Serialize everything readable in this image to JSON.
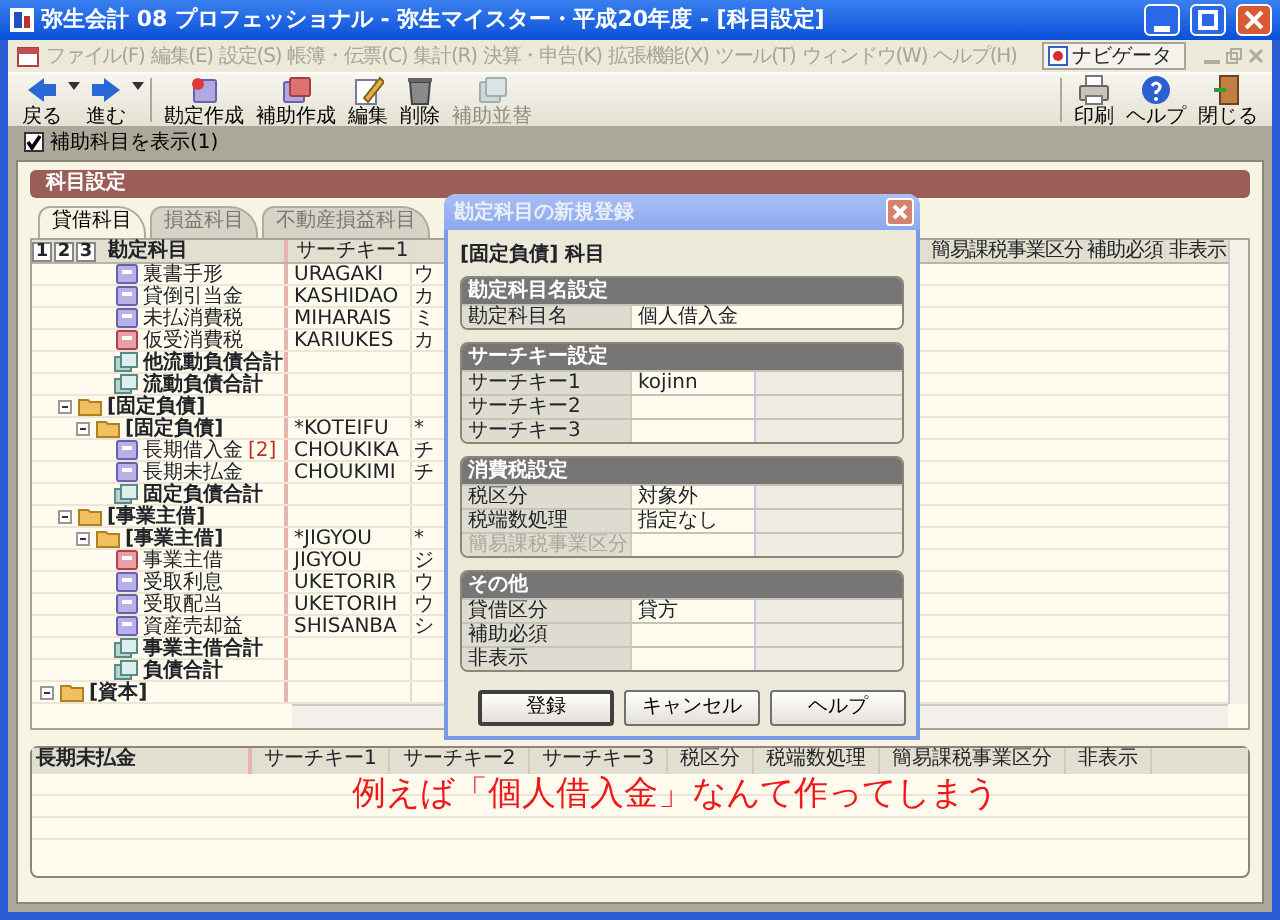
{
  "window": {
    "title": "弥生会計 08 プロフェッショナル - 弥生マイスター・平成20年度 - [科目設定]"
  },
  "menu": [
    {
      "label": "ファイル(F)",
      "disabled": true
    },
    {
      "label": "編集(E)",
      "disabled": true
    },
    {
      "label": "設定(S)",
      "disabled": true
    },
    {
      "label": "帳簿・伝票(C)",
      "disabled": true
    },
    {
      "label": "集計(R)",
      "disabled": true
    },
    {
      "label": "決算・申告(K)",
      "disabled": true
    },
    {
      "label": "拡張機能(X)",
      "disabled": true
    },
    {
      "label": "ツール(T)",
      "disabled": true
    },
    {
      "label": "ウィンドウ(W)",
      "disabled": true
    },
    {
      "label": "ヘルプ(H)",
      "disabled": true
    }
  ],
  "navigator": {
    "label": "ナビゲータ"
  },
  "toolbar": [
    {
      "label": "戻る",
      "kind": "back",
      "dropdown": true,
      "disabled": false
    },
    {
      "label": "進む",
      "kind": "forward",
      "dropdown": true,
      "disabled": false
    },
    {
      "label": "勘定作成",
      "kind": "new-account",
      "disabled": false
    },
    {
      "label": "補助作成",
      "kind": "new-sub",
      "disabled": false
    },
    {
      "label": "編集",
      "kind": "edit",
      "disabled": false
    },
    {
      "label": "削除",
      "kind": "delete",
      "disabled": false
    },
    {
      "label": "補助並替",
      "kind": "reorder",
      "disabled": true
    }
  ],
  "toolbar_right": [
    {
      "label": "印刷",
      "kind": "print"
    },
    {
      "label": "ヘルプ",
      "kind": "help"
    },
    {
      "label": "閉じる",
      "kind": "close"
    }
  ],
  "show_sub_accounts": {
    "label": "補助科目を表示(1)",
    "checked": true
  },
  "panel_title": "科目設定",
  "tabs": [
    {
      "label": "貸借科目",
      "selected": true
    },
    {
      "label": "損益科目",
      "selected": false
    },
    {
      "label": "不動産損益科目",
      "selected": false
    }
  ],
  "grid": {
    "level_buttons": [
      "1",
      "2",
      "3"
    ],
    "columns": [
      "勘定科目",
      "サーチキー1"
    ],
    "right_columns": [
      "簡易課税事業区分",
      "補助必須",
      "非表示"
    ],
    "tree": [
      {
        "children": [
          {
            "children": [
              {
                "children": [
                  {
                    "label": "裏書手形",
                    "kind": "account",
                    "key1": "URAGAKI",
                    "key2": "ウ"
                  },
                  {
                    "label": "貸倒引当金",
                    "kind": "account",
                    "key1": "KASHIDAO",
                    "key2": "カ"
                  },
                  {
                    "label": "未払消費税",
                    "kind": "account",
                    "key1": "MIHARAIS",
                    "key2": "ミ"
                  },
                  {
                    "label": "仮受消費税",
                    "kind": "tax",
                    "key1": "KARIUKES",
                    "key2": "カ"
                  },
                  {
                    "label": "他流動負債合計",
                    "kind": "total"
                  },
                  {
                    "label": "流動負債合計",
                    "kind": "total"
                  }
                ]
              }
            ]
          },
          {
            "label": "[固定負債]",
            "kind": "folder",
            "expanded": true,
            "children": [
              {
                "label": "[固定負債]",
                "kind": "folder",
                "expanded": true,
                "key1": "*KOTEIFU",
                "key2": "*",
                "children": [
                  {
                    "label": "長期借入金",
                    "count": "[2]",
                    "kind": "account",
                    "key1": "CHOUKIKA",
                    "key2": "チ"
                  },
                  {
                    "label": "長期未払金",
                    "kind": "account",
                    "key1": "CHOUKIMI",
                    "key2": "チ"
                  },
                  {
                    "label": "固定負債合計",
                    "kind": "total"
                  }
                ]
              }
            ]
          },
          {
            "label": "[事業主借]",
            "kind": "folder",
            "expanded": true,
            "children": [
              {
                "label": "[事業主借]",
                "kind": "folder",
                "expanded": true,
                "key1": "*JIGYOU",
                "key2": "*",
                "children": [
                  {
                    "label": "事業主借",
                    "kind": "tax",
                    "key1": "JIGYOU",
                    "key2": "ジ"
                  },
                  {
                    "label": "受取利息",
                    "kind": "account",
                    "key1": "UKETORIR",
                    "key2": "ウ"
                  },
                  {
                    "label": "受取配当",
                    "kind": "account",
                    "key1": "UKETORIH",
                    "key2": "ウ"
                  },
                  {
                    "label": "資産売却益",
                    "kind": "account",
                    "key1": "SHISANBA",
                    "key2": "シ"
                  },
                  {
                    "label": "事業主借合計",
                    "kind": "total"
                  },
                  {
                    "label": "負債合計",
                    "kind": "total"
                  }
                ]
              }
            ]
          }
        ]
      },
      {
        "label": "[資本]",
        "kind": "folder",
        "expanded": true
      }
    ]
  },
  "detail": {
    "title": "長期未払金",
    "columns": [
      "サーチキー1",
      "サーチキー2",
      "サーチキー3",
      "税区分",
      "税端数処理",
      "簡易課税事業区分",
      "非表示"
    ],
    "annotation": "例えば「個人借入金」なんて作ってしまう"
  },
  "dialog": {
    "title": "勘定科目の新規登録",
    "subtitle": "[固定負債] 科目",
    "groups": [
      {
        "title": "勘定科目名設定",
        "kind": "single",
        "rows": [
          {
            "label": "勘定科目名",
            "value": "個人借入金",
            "disabled": false
          }
        ]
      },
      {
        "title": "サーチキー設定",
        "kind": "triple",
        "rows": [
          {
            "label": "サーチキー1",
            "value": "kojinn",
            "disabled": false
          },
          {
            "label": "サーチキー2",
            "disabled": false
          },
          {
            "label": "サーチキー3",
            "disabled": false
          }
        ]
      },
      {
        "title": "消費税設定",
        "kind": "triple",
        "rows": [
          {
            "label": "税区分",
            "value": "対象外",
            "disabled": false
          },
          {
            "label": "税端数処理",
            "value": "指定なし",
            "disabled": false
          },
          {
            "label": "簡易課税事業区分",
            "disabled": true
          }
        ]
      },
      {
        "title": "その他",
        "kind": "triple",
        "rows": [
          {
            "label": "貸借区分",
            "value": "貸方",
            "disabled": false
          },
          {
            "label": "補助必須",
            "disabled": false
          },
          {
            "label": "非表示",
            "disabled": false
          }
        ]
      }
    ],
    "buttons": [
      {
        "label": "登録",
        "default": true
      },
      {
        "label": "キャンセル",
        "default": false
      },
      {
        "label": "ヘルプ",
        "default": false
      }
    ]
  }
}
